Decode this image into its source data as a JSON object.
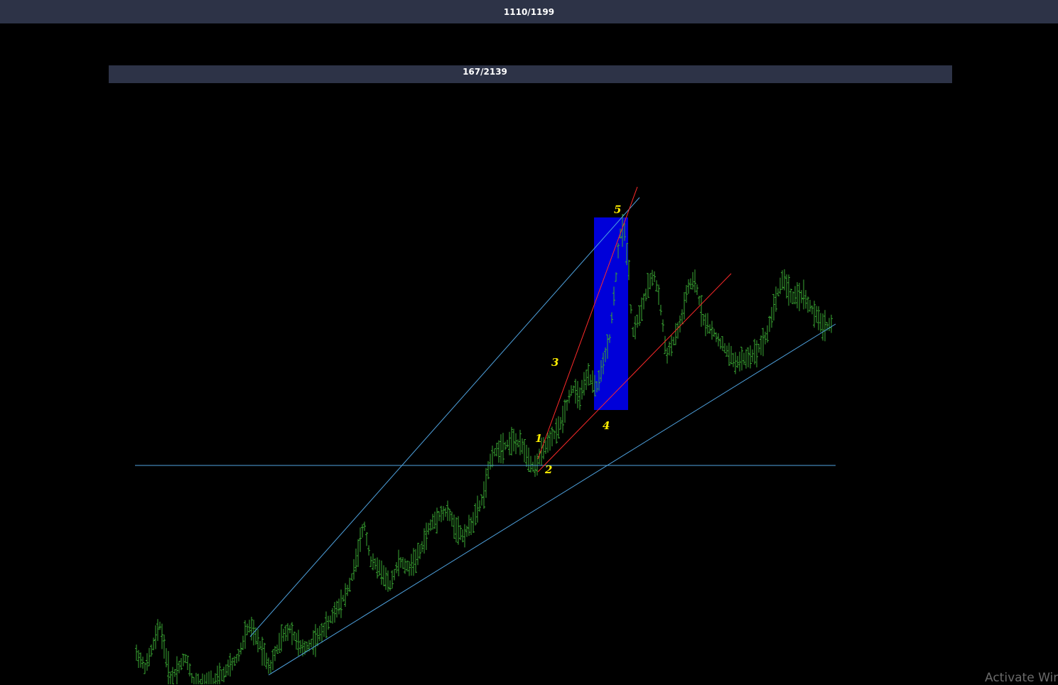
{
  "header": {
    "counter": "1110/1199"
  },
  "subheader": {
    "counter": "167/2139"
  },
  "watermark": {
    "text": "Activate Wir"
  },
  "chart_data": {
    "type": "bar",
    "style": "ohlc",
    "bar_color": "#3aa833",
    "background": "#000000",
    "highlight_color": "#0000ff",
    "trendline_blue": "#4fa3e0",
    "trendline_red": "#ff2a2a",
    "label_color": "#ffee00",
    "wave_labels": [
      "1",
      "2",
      "3",
      "4",
      "5"
    ]
  }
}
